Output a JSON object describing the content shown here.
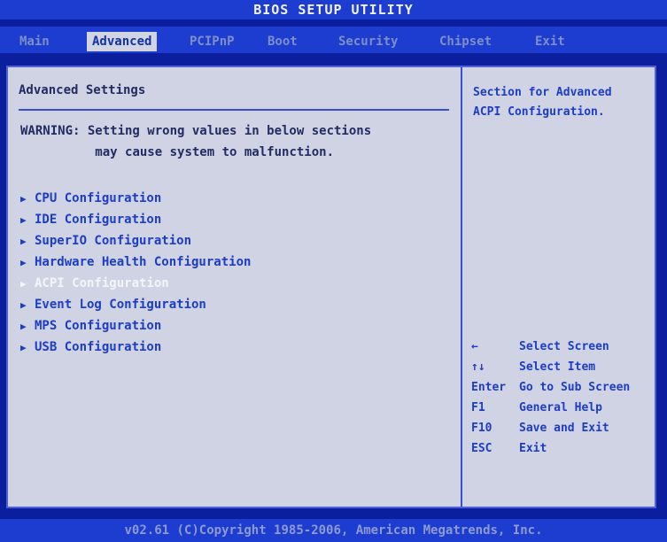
{
  "title": "BIOS SETUP UTILITY",
  "tabs": [
    {
      "label": "Main",
      "active": false
    },
    {
      "label": "Advanced",
      "active": true
    },
    {
      "label": "PCIPnP",
      "active": false
    },
    {
      "label": "Boot",
      "active": false
    },
    {
      "label": "Security",
      "active": false
    },
    {
      "label": "Chipset",
      "active": false
    },
    {
      "label": "Exit",
      "active": false
    }
  ],
  "main": {
    "heading": "Advanced Settings",
    "warning_line1": "WARNING: Setting wrong values in below sections",
    "warning_line2": "may cause system to malfunction.",
    "items": [
      {
        "label": "CPU Configuration",
        "icon": "triangle-right-icon"
      },
      {
        "label": "IDE Configuration",
        "icon": "triangle-right-icon"
      },
      {
        "label": "SuperIO Configuration",
        "icon": "triangle-right-icon"
      },
      {
        "label": "Hardware Health Configuration",
        "icon": "triangle-right-icon"
      },
      {
        "label": "ACPI Configuration",
        "icon": "triangle-right-icon",
        "selected": true
      },
      {
        "label": "Event Log Configuration",
        "icon": "triangle-right-icon"
      },
      {
        "label": "MPS Configuration",
        "icon": "triangle-right-icon"
      },
      {
        "label": "USB Configuration",
        "icon": "triangle-right-icon"
      }
    ]
  },
  "help": {
    "line1": "Section for Advanced",
    "line2": "ACPI Configuration."
  },
  "keys": [
    {
      "key": "←",
      "action": "Select Screen"
    },
    {
      "key": "↑↓",
      "action": "Select Item"
    },
    {
      "key": "Enter",
      "action": "Go to Sub Screen"
    },
    {
      "key": "F1",
      "action": "General Help"
    },
    {
      "key": "F10",
      "action": "Save and Exit"
    },
    {
      "key": "ESC",
      "action": "Exit"
    }
  ],
  "footer": "v02.61 (C)Copyright 1985-2006, American Megatrends, Inc.",
  "colors": {
    "background": "#0b1f9e",
    "panel": "#cfd3e3",
    "item_text": "#1d3dc4",
    "selected_text": "#f4f5fa"
  }
}
